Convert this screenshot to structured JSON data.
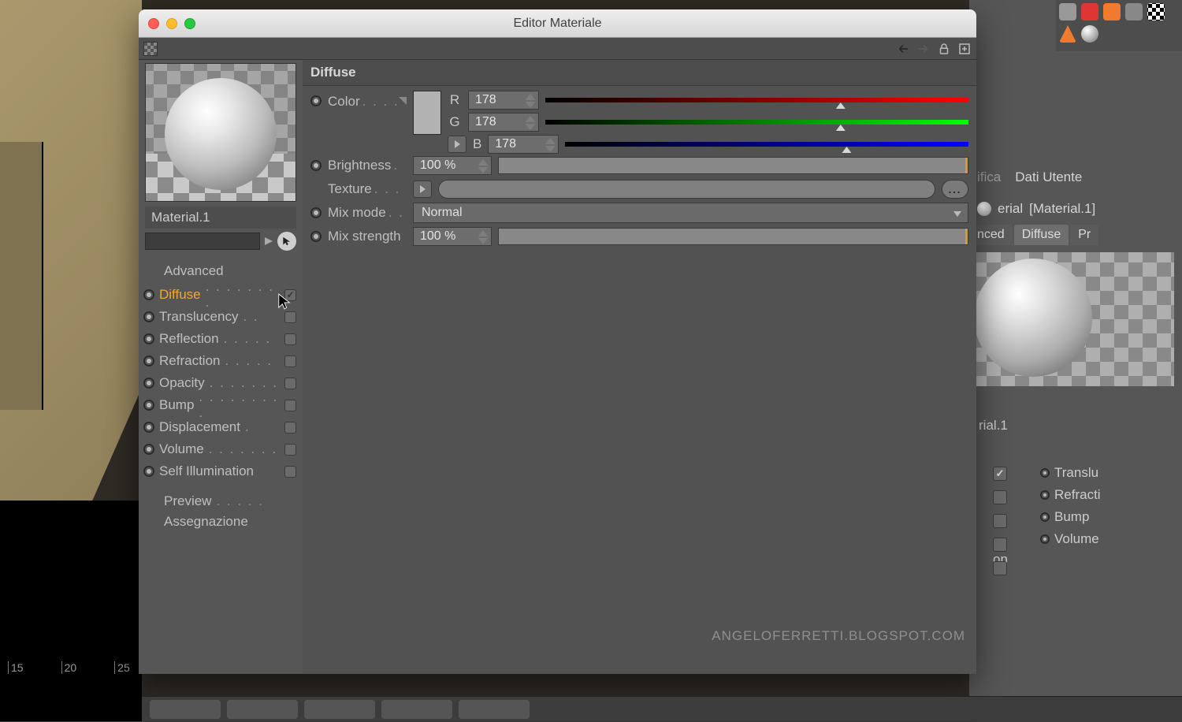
{
  "window": {
    "title": "Editor Materiale"
  },
  "material": {
    "name": "Material.1"
  },
  "sidebar": {
    "advanced": "Advanced",
    "channels": [
      {
        "label": "Diffuse",
        "checked": true,
        "selected": true
      },
      {
        "label": "Translucency",
        "checked": false
      },
      {
        "label": "Reflection",
        "checked": false
      },
      {
        "label": "Refraction",
        "checked": false
      },
      {
        "label": "Opacity",
        "checked": false
      },
      {
        "label": "Bump",
        "checked": false
      },
      {
        "label": "Displacement",
        "checked": false
      },
      {
        "label": "Volume",
        "checked": false
      },
      {
        "label": "Self Illumination",
        "checked": false
      }
    ],
    "preview": "Preview",
    "assignment": "Assegnazione"
  },
  "panel": {
    "heading": "Diffuse",
    "color_label": "Color",
    "r_label": "R",
    "r_value": "178",
    "g_label": "G",
    "g_value": "178",
    "b_label": "B",
    "b_value": "178",
    "slider_pct": 69.8,
    "brightness_label": "Brightness",
    "brightness_value": "100 %",
    "texture_label": "Texture",
    "mixmode_label": "Mix mode",
    "mixmode_value": "Normal",
    "mixstrength_label": "Mix strength",
    "mixstrength_value": "100 %",
    "browse": "..."
  },
  "right": {
    "tab_ifica": "ifica",
    "tab_dati": "Dati Utente",
    "title_prefix": "erial",
    "title_name": "[Material.1]",
    "sub_nced": "nced",
    "sub_diffuse": "Diffuse",
    "sub_pr": "Pr",
    "matname": "rial.1",
    "ch_translu": "Translu",
    "ch_refracti": "Refracti",
    "ch_bump": "Bump",
    "ch_volume": "Volume",
    "ch_on": "on"
  },
  "timeline": {
    "t15": "15",
    "t20": "20",
    "t25": "25"
  },
  "watermark": "ANGELOFERRETTI.BLOGSPOT.COM"
}
